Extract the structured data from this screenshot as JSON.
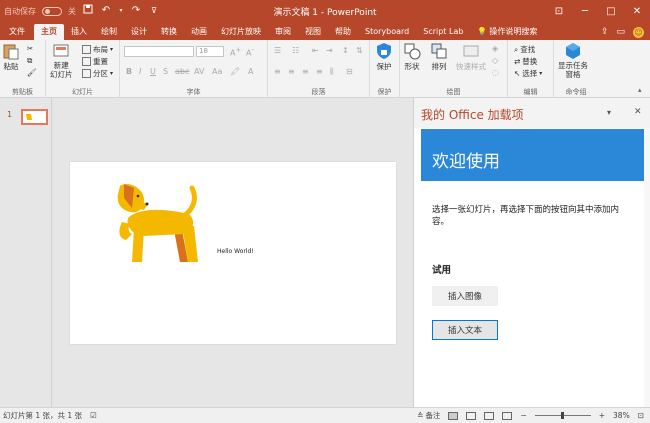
{
  "titlebar": {
    "autosave_label": "自动保存",
    "autosave_state": "关",
    "doc_title": "演示文稿 1 - PowerPoint",
    "icons": [
      "save-icon",
      "undo-icon",
      "redo-icon",
      "customize-icon"
    ]
  },
  "tabs": [
    {
      "label": "文件"
    },
    {
      "label": "主页"
    },
    {
      "label": "插入"
    },
    {
      "label": "绘制"
    },
    {
      "label": "设计"
    },
    {
      "label": "转换"
    },
    {
      "label": "动画"
    },
    {
      "label": "幻灯片放映"
    },
    {
      "label": "审阅"
    },
    {
      "label": "视图"
    },
    {
      "label": "帮助"
    },
    {
      "label": "Storyboard"
    },
    {
      "label": "Script Lab"
    }
  ],
  "search_label": "操作说明搜索",
  "ribbon": {
    "paste": "粘贴",
    "clipboard_group": "剪贴板",
    "new_slide": "新建\n幻灯片",
    "layout": "布局",
    "reset": "重置",
    "section": "分区",
    "slides_group": "幻灯片",
    "font_size": "18",
    "font_group": "字体",
    "paragraph_group": "段落",
    "protect": "保护",
    "protect_group": "保护",
    "shape": "形状",
    "arrange": "排列",
    "quick_styles": "快速样式",
    "drawing_group": "绘图",
    "find": "查找",
    "replace": "替换",
    "select": "选择",
    "editing_group": "编辑",
    "show_taskpane": "显示任务\n窗格",
    "commands_group": "命令组"
  },
  "thumbnail": {
    "number": "1"
  },
  "slide": {
    "text": "Hello World!"
  },
  "taskpane": {
    "title": "我的 Office 加载项",
    "banner": "欢迎使用",
    "description": "选择一张幻灯片，再选择下面的按钮向其中添加内容。",
    "section": "试用",
    "insert_image": "插入图像",
    "insert_text": "插入文本"
  },
  "status": {
    "slide_info": "幻灯片第 1 张，共 1 张",
    "notes": "备注",
    "zoom": "38%"
  },
  "colors": {
    "accent": "#b7472a",
    "banner": "#2b88d8",
    "dog": "#f5b800"
  }
}
